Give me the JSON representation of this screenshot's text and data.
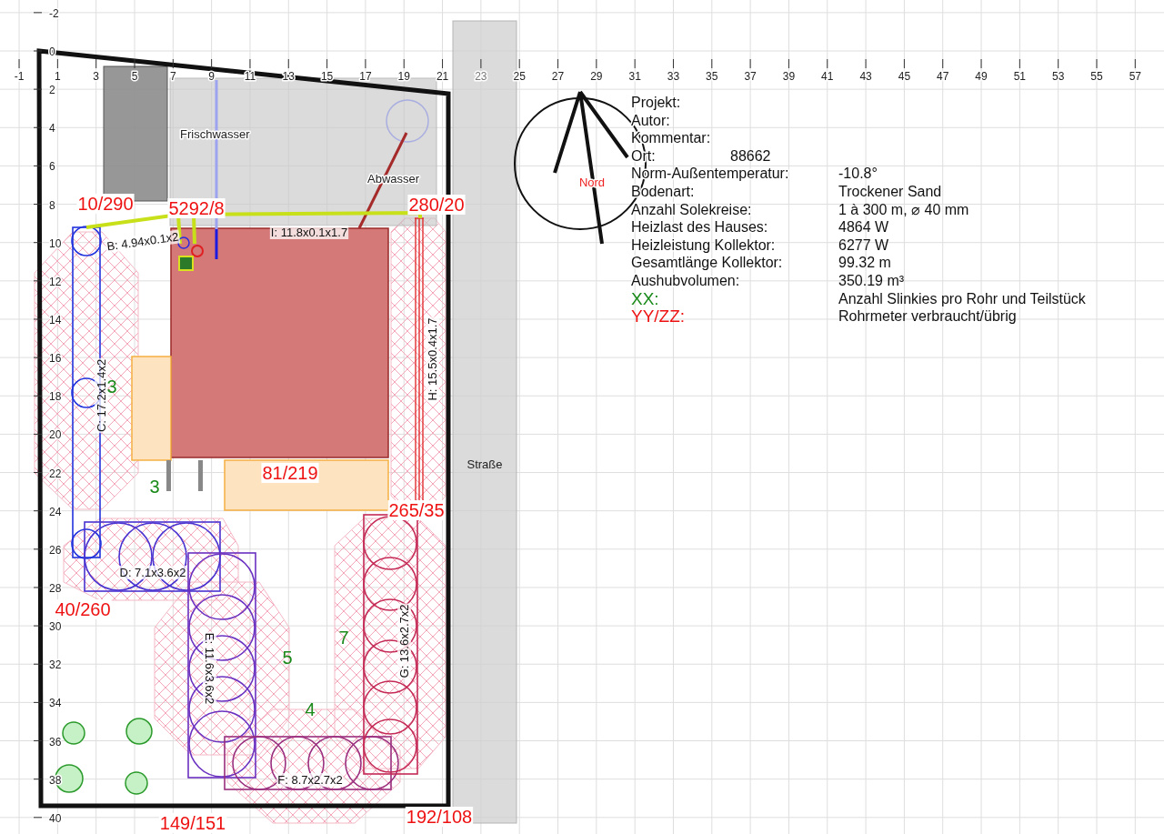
{
  "axes": {
    "x_ticks": [
      "-1",
      "1",
      "3",
      "5",
      "7",
      "9",
      "11",
      "13",
      "15",
      "17",
      "19",
      "21",
      "23",
      "25",
      "27",
      "29",
      "31",
      "33",
      "35",
      "37",
      "39",
      "41",
      "43",
      "45",
      "47",
      "49",
      "51",
      "53",
      "55",
      "57"
    ],
    "y_ticks": [
      "-2",
      "0",
      "2",
      "4",
      "6",
      "8",
      "10",
      "12",
      "14",
      "16",
      "18",
      "20",
      "22",
      "24",
      "26",
      "28",
      "30",
      "32",
      "34",
      "36",
      "38",
      "40"
    ]
  },
  "plan": {
    "area_labels": [
      "Frischwasser",
      "Abwasser"
    ],
    "collector_labels": [
      "B: 4.94x0.1x2",
      "I: 11.8x0.1x1.7",
      "C: 17.2x1.4x2",
      "H: 15.5x0.4x1.7",
      "D: 7.1x3.6x2",
      "E: 11.6x3.6x2",
      "G: 13.6x2.7x2",
      "F: 8.7x2.7x2"
    ],
    "pipe_usage": [
      "10/290",
      "5292/8",
      "280/20",
      "81/219",
      "265/35",
      "40/260",
      "149/151",
      "192/108"
    ],
    "slinky_counts": [
      "3",
      "3",
      "5",
      "7",
      "4"
    ],
    "street_label": "Straße",
    "compass_label": "Nord"
  },
  "info_panel": {
    "rows": [
      {
        "label": "Projekt:"
      },
      {
        "label": "Autor:"
      },
      {
        "label": "Kommentar:"
      },
      {
        "label": "Ort:",
        "value": "88662",
        "kind": "short"
      },
      {
        "label": "Norm-Außentemperatur:",
        "value": "-10.8°",
        "kind": "wide"
      },
      {
        "label": "Bodenart:",
        "value": "Trockener Sand",
        "kind": "wide"
      },
      {
        "label": "Anzahl Solekreise:",
        "value": "1 à 300 m, ⌀ 40 mm",
        "kind": "wide"
      },
      {
        "label": "Heizlast des Hauses:",
        "value": "4864 W",
        "kind": "wide"
      },
      {
        "label": "Heizleistung Kollektor:",
        "value": "6277 W",
        "kind": "wide"
      },
      {
        "label": "Gesamtlänge Kollektor:",
        "value": "99.32 m",
        "kind": "wide"
      },
      {
        "label": "Aushubvolumen:",
        "value": "350.19 m³",
        "kind": "wide"
      }
    ],
    "legend": [
      {
        "key": "XX:",
        "description": "Anzahl Slinkies pro Rohr und Teilstück",
        "color": "#1a8a1a"
      },
      {
        "key": "YY/ZZ:",
        "description": "Rohrmeter verbraucht/übrig",
        "color": "#ee1111"
      }
    ]
  }
}
